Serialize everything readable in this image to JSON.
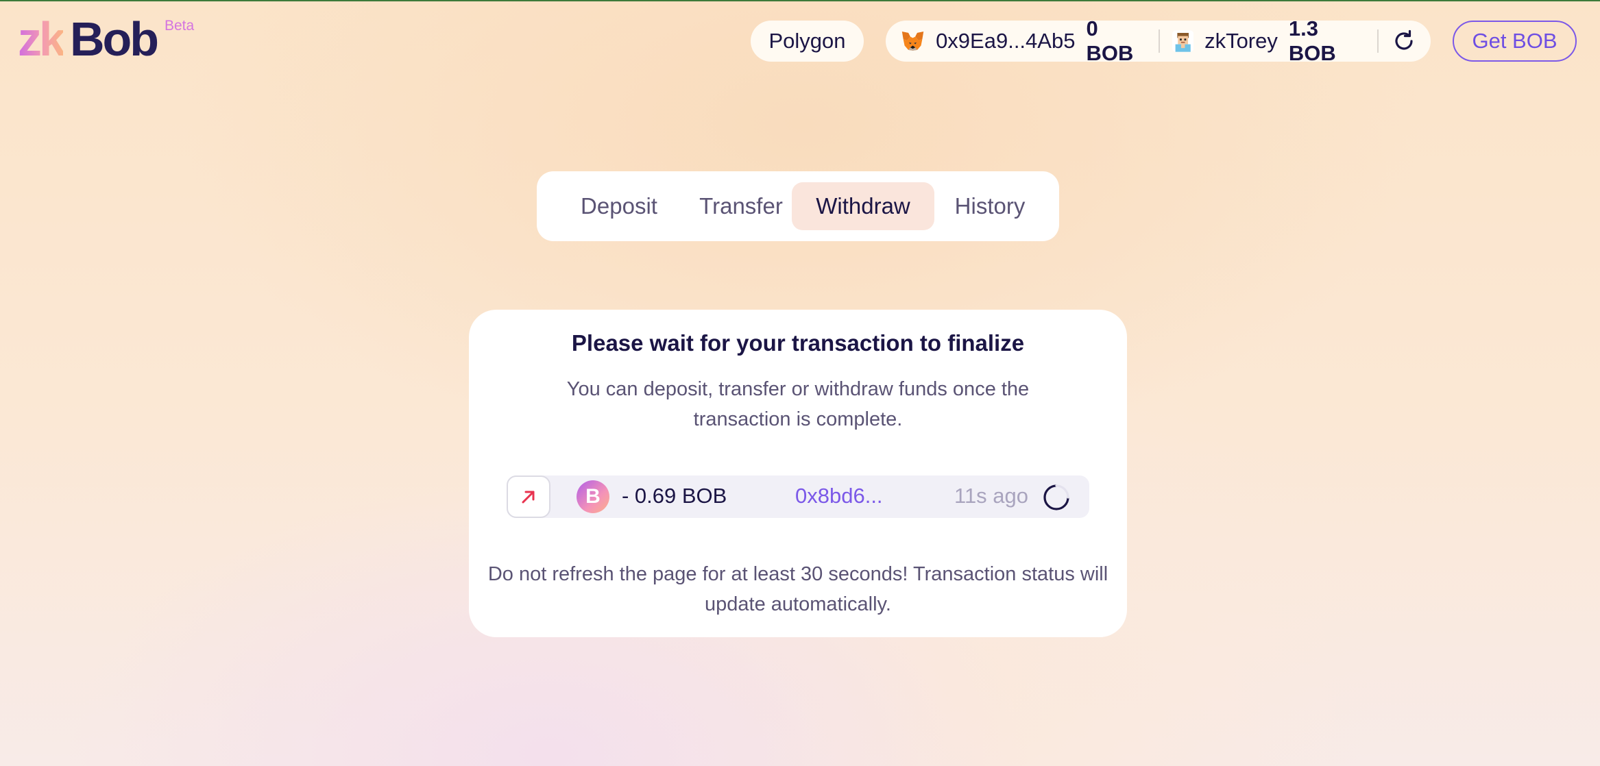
{
  "brand": {
    "logo_zk": "zk",
    "logo_bob": "Bob",
    "badge": "Beta"
  },
  "header": {
    "network": "Polygon",
    "wallet": {
      "address": "0x9Ea9...4Ab5",
      "balance": "0 BOB",
      "account_name": "zkTorey",
      "account_balance": "1.3 BOB"
    },
    "get_bob_label": "Get BOB"
  },
  "tabs": [
    {
      "label": "Deposit",
      "active": false
    },
    {
      "label": "Transfer",
      "active": false
    },
    {
      "label": "Withdraw",
      "active": true
    },
    {
      "label": "History",
      "active": false
    }
  ],
  "pending": {
    "title": "Please wait for your transaction to finalize",
    "subtitle": "You can deposit, transfer or withdraw funds once the transaction is complete.",
    "transaction": {
      "direction_icon": "arrow-up-right-icon",
      "token_icon": "bob-token-icon",
      "amount": "- 0.69 BOB",
      "hash": "0x8bd6...",
      "time": "11s ago",
      "status_icon": "spinner-icon"
    },
    "footer_note": "Do not refresh the page for at least 30 seconds! Transaction status will update automatically."
  },
  "colors": {
    "accent": "#7b58e8",
    "text_primary": "#1b1545",
    "text_secondary": "#5a5374",
    "active_tab_bg": "#fae5dc",
    "withdraw_arrow": "#e8334f"
  }
}
